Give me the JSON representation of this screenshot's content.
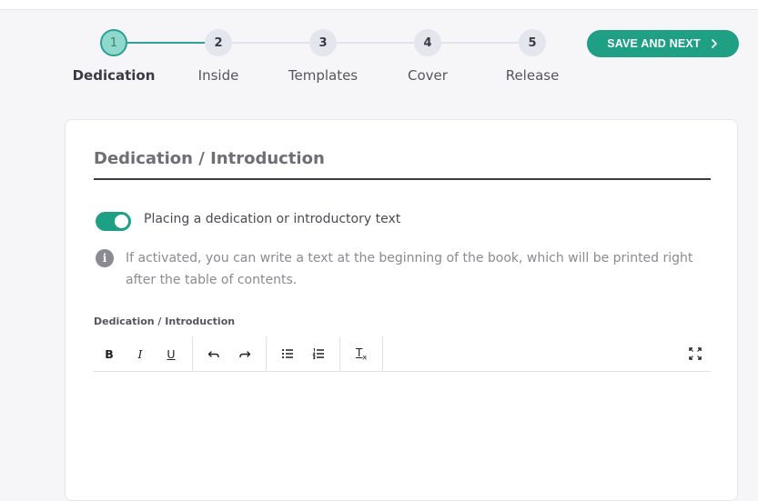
{
  "stepper": {
    "steps": [
      {
        "number": "1",
        "label": "Dedication"
      },
      {
        "number": "2",
        "label": "Inside"
      },
      {
        "number": "3",
        "label": "Templates"
      },
      {
        "number": "4",
        "label": "Cover"
      },
      {
        "number": "5",
        "label": "Release"
      }
    ],
    "active_step": 1
  },
  "save_button": {
    "label": "SAVE AND NEXT"
  },
  "section": {
    "title": "Dedication / Introduction",
    "toggle_label": "Placing a dedication or introductory text",
    "toggle_on": true,
    "info_text": "If activated, you can write a text at the beginning of the book, which will be printed right after the table of contents.",
    "field_label": "Dedication / Introduction"
  },
  "toolbar": {
    "bold": "B",
    "italic": "I",
    "underline": "U",
    "clear_format": "Tx"
  },
  "colors": {
    "accent": "#1fa085",
    "step_active": "#8fd8cc",
    "step_inactive": "#e4e6ee"
  }
}
